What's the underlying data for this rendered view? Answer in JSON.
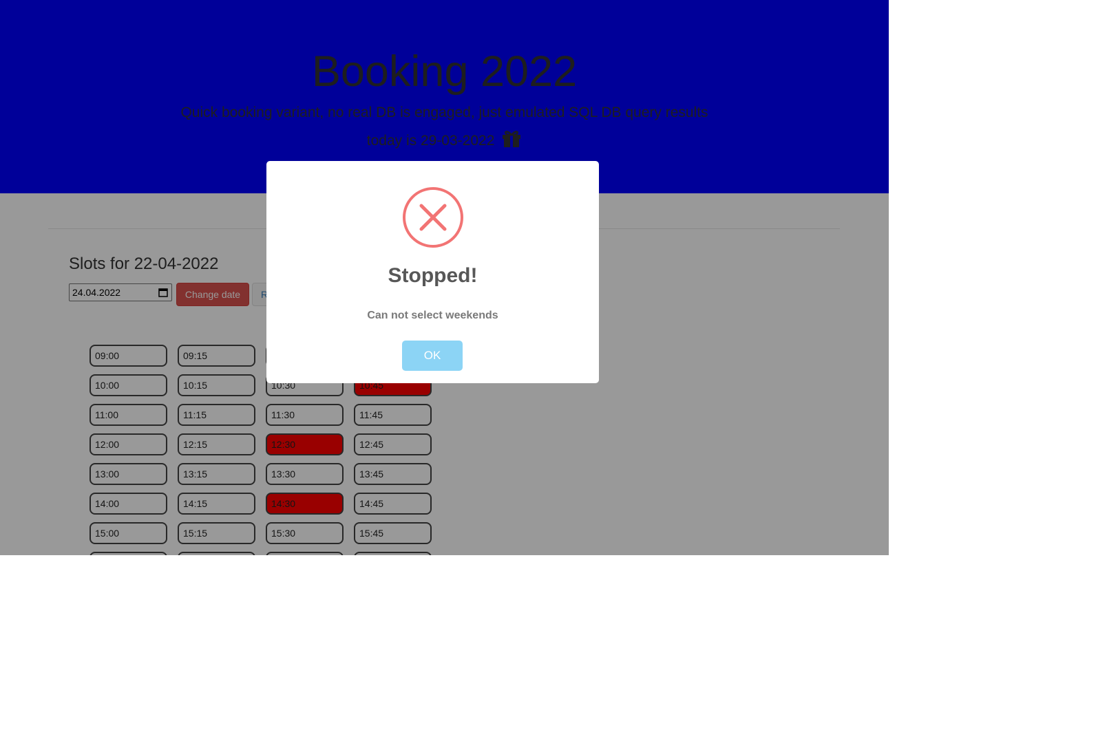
{
  "header": {
    "title": "Booking 2022",
    "subtitle": "Quick booking variant, no real DB is engaged, just emulated SQL DB query results",
    "today": "today is 29-03-2022",
    "today_icon": "gift-icon"
  },
  "colors": {
    "hero_bg": "#0000ff",
    "booked_slot": "#ff0000",
    "change_button": "#d9534f",
    "ok_button": "#8cd4f5",
    "error_icon": "#f27474"
  },
  "slots_section": {
    "title": "Slots for 22-04-2022",
    "date_value": "24.04.2022",
    "change_label": "Change date",
    "reset_label": "R"
  },
  "slots": [
    {
      "time": "09:00",
      "booked": false
    },
    {
      "time": "09:15",
      "booked": false
    },
    {
      "time": "",
      "booked": false
    },
    {
      "time": "",
      "booked": false
    },
    {
      "time": "10:00",
      "booked": false
    },
    {
      "time": "10:15",
      "booked": false
    },
    {
      "time": "10:30",
      "booked": false
    },
    {
      "time": "10:45",
      "booked": true
    },
    {
      "time": "11:00",
      "booked": false
    },
    {
      "time": "11:15",
      "booked": false
    },
    {
      "time": "11:30",
      "booked": false
    },
    {
      "time": "11:45",
      "booked": false
    },
    {
      "time": "12:00",
      "booked": false
    },
    {
      "time": "12:15",
      "booked": false
    },
    {
      "time": "12:30",
      "booked": true
    },
    {
      "time": "12:45",
      "booked": false
    },
    {
      "time": "13:00",
      "booked": false
    },
    {
      "time": "13:15",
      "booked": false
    },
    {
      "time": "13:30",
      "booked": false
    },
    {
      "time": "13:45",
      "booked": false
    },
    {
      "time": "14:00",
      "booked": false
    },
    {
      "time": "14:15",
      "booked": false
    },
    {
      "time": "14:30",
      "booked": true
    },
    {
      "time": "14:45",
      "booked": false
    },
    {
      "time": "15:00",
      "booked": false
    },
    {
      "time": "15:15",
      "booked": false
    },
    {
      "time": "15:30",
      "booked": false
    },
    {
      "time": "15:45",
      "booked": false
    },
    {
      "time": "",
      "booked": false
    },
    {
      "time": "",
      "booked": false
    },
    {
      "time": "",
      "booked": false
    },
    {
      "time": "",
      "booked": false
    }
  ],
  "modal": {
    "icon": "error-x-icon",
    "title": "Stopped!",
    "text": "Can not select weekends",
    "ok_label": "OK"
  }
}
